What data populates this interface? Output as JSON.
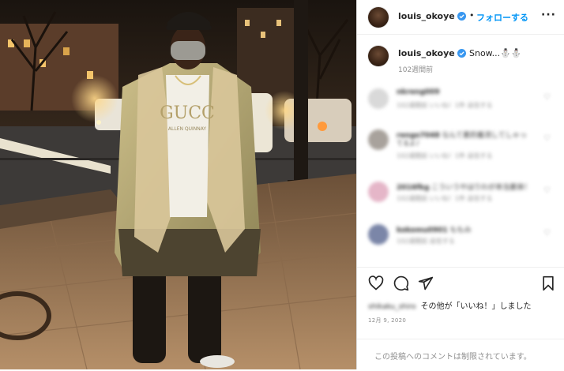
{
  "post": {
    "photo_alt": "man in shearling coat on night street",
    "shirt_text": "GUCC",
    "shirt_subtext": "ALLEN QUINNAY"
  },
  "header": {
    "username": "louis_okoye",
    "separator": "•",
    "follow_label": "フォローする",
    "more_label": "···"
  },
  "caption": {
    "username": "louis_okoye",
    "text": "Snow...⛄⛄",
    "time_ago": "102週間前"
  },
  "comments": [
    {
      "user": "nkreng009",
      "text": "",
      "meta": "102週間前   いいね！1件   返信する",
      "avatar_color": "#d9d9d9"
    },
    {
      "user": "rengo7048",
      "text": "なんて素的着流してしゃっ",
      "text2": "てるよ♪",
      "meta": "102週間前   いいね！1件   返信する",
      "avatar_color": "#a8a29c"
    },
    {
      "user": "2016fkg",
      "text": "こういうやはりわが本当素体！",
      "meta": "102週間前   いいね！1件   返信する",
      "avatar_color": "#e5b6c8"
    },
    {
      "user": "kokomu0901",
      "text": "ももみ",
      "meta": "102週間前   返信する",
      "avatar_color": "#7b86a8"
    }
  ],
  "actions": {
    "like_icon": "heart-icon",
    "comment_icon": "comment-icon",
    "share_icon": "send-icon",
    "save_icon": "bookmark-icon",
    "likes_user": "shikaku_shiro",
    "likes_text": "その他が「いいね！」しました",
    "date": "12月 9, 2020"
  },
  "comments_closed": "この投稿へのコメントは制限されています。",
  "colors": {
    "accent": "#0095f6",
    "verified": "#3897f0",
    "muted": "#8e8e8e"
  }
}
